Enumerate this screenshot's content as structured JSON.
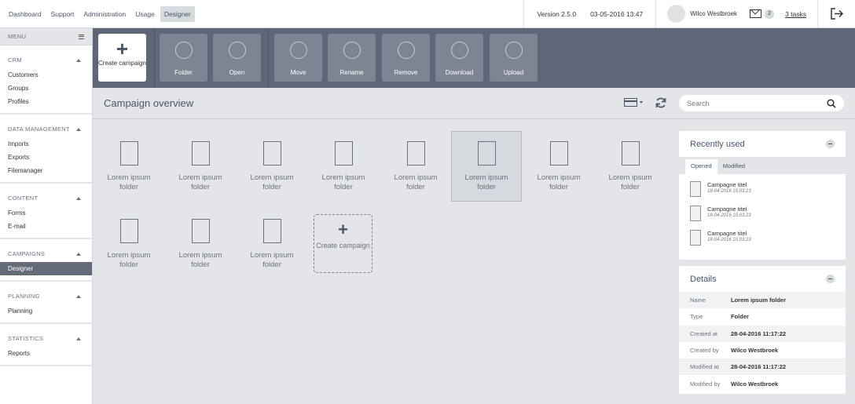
{
  "topnav": {
    "items": [
      "Dashboard",
      "Support",
      "Administration",
      "Usage",
      "Designer"
    ],
    "active_index": 4
  },
  "header": {
    "version": "Version 2.5.0",
    "datetime": "03-05-2016 13:47",
    "user_name": "Wilco Westbroek",
    "mail_count": "2",
    "tasks": "3 tasks"
  },
  "sidebar": {
    "menu_label": "MENU",
    "sections": [
      {
        "title": "CRM",
        "items": [
          "Customers",
          "Groups",
          "Profiles"
        ]
      },
      {
        "title": "DATA MANAGEMENT",
        "items": [
          "Imports",
          "Exports",
          "Filemanager"
        ]
      },
      {
        "title": "CONTENT",
        "items": [
          "Forms",
          "E-mail"
        ]
      },
      {
        "title": "CAMPAIGNS",
        "items": [
          "Designer"
        ]
      },
      {
        "title": "PLANNING",
        "items": [
          "Planning"
        ]
      },
      {
        "title": "STATISTICS",
        "items": [
          "Reports"
        ]
      }
    ],
    "active_item": "Designer"
  },
  "toolbar": {
    "create_label": "Create campaign",
    "buttons": [
      "Folder",
      "Open",
      "Move",
      "Rename",
      "Remove",
      "Download",
      "Upload"
    ]
  },
  "content": {
    "title": "Campaign overview",
    "search_placeholder": "Search",
    "folders": [
      "Lorem ipsum folder",
      "Lorem ipsum folder",
      "Lorem ipsum folder",
      "Lorem ipsum folder",
      "Lorem ipsum folder",
      "Lorem ipsum folder",
      "Lorem ipsum folder",
      "Lorem ipsum folder",
      "Lorem ipsum folder",
      "Lorem ipsum folder",
      "Lorem ipsum folder"
    ],
    "selected_index": 5,
    "create_tile_label": "Create campaign"
  },
  "recently_used": {
    "title": "Recently used",
    "tabs": [
      "Opened",
      "Modified"
    ],
    "items": [
      {
        "title": "Campagne titel",
        "date": "18-04-2016 15:03:23"
      },
      {
        "title": "Campagne titel",
        "date": "18-04-2016 15:03:23"
      },
      {
        "title": "Campagne titel",
        "date": "18-04-2016 15:03:23"
      }
    ]
  },
  "details": {
    "title": "Details",
    "rows": [
      {
        "key": "Name",
        "value": "Lorem ipsum folder"
      },
      {
        "key": "Type",
        "value": "Folder"
      },
      {
        "key": "Created at",
        "value": "28-04-2016 11:17:22"
      },
      {
        "key": "Created by",
        "value": "Wilco Westbroek"
      },
      {
        "key": "Modified at",
        "value": "28-04-2016 11:17:22"
      },
      {
        "key": "Modified by",
        "value": "Wilco Westbroek"
      }
    ]
  }
}
